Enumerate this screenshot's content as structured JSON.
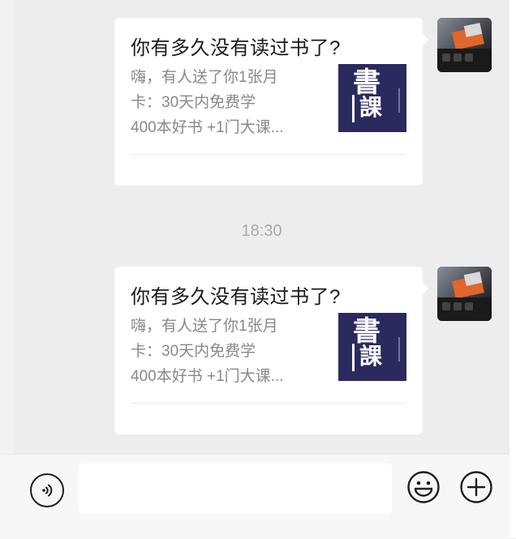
{
  "messages": [
    {
      "title": "你有多久没有读过书了?",
      "desc_lines": [
        "嗨，有人送了你1张月",
        "卡：30天内免费学",
        "400本好书 +1门大课..."
      ],
      "thumb_text": [
        "書",
        "課"
      ]
    },
    {
      "title": "你有多久没有读过书了?",
      "desc_lines": [
        "嗨，有人送了你1张月",
        "卡：30天内免费学",
        "400本好书 +1门大课..."
      ],
      "thumb_text": [
        "書",
        "課"
      ]
    }
  ],
  "timestamp": "18:30",
  "input": {
    "value": "",
    "placeholder": ""
  },
  "icons": {
    "voice": "voice-icon",
    "emoji": "emoji-icon",
    "plus": "plus-icon"
  },
  "colors": {
    "chat_background": "#ededed",
    "bubble": "#ffffff",
    "thumb_background": "#2b2a5f",
    "title_text": "#1a1a1a",
    "desc_text": "#888888",
    "timestamp_text": "#a9a9a9"
  }
}
